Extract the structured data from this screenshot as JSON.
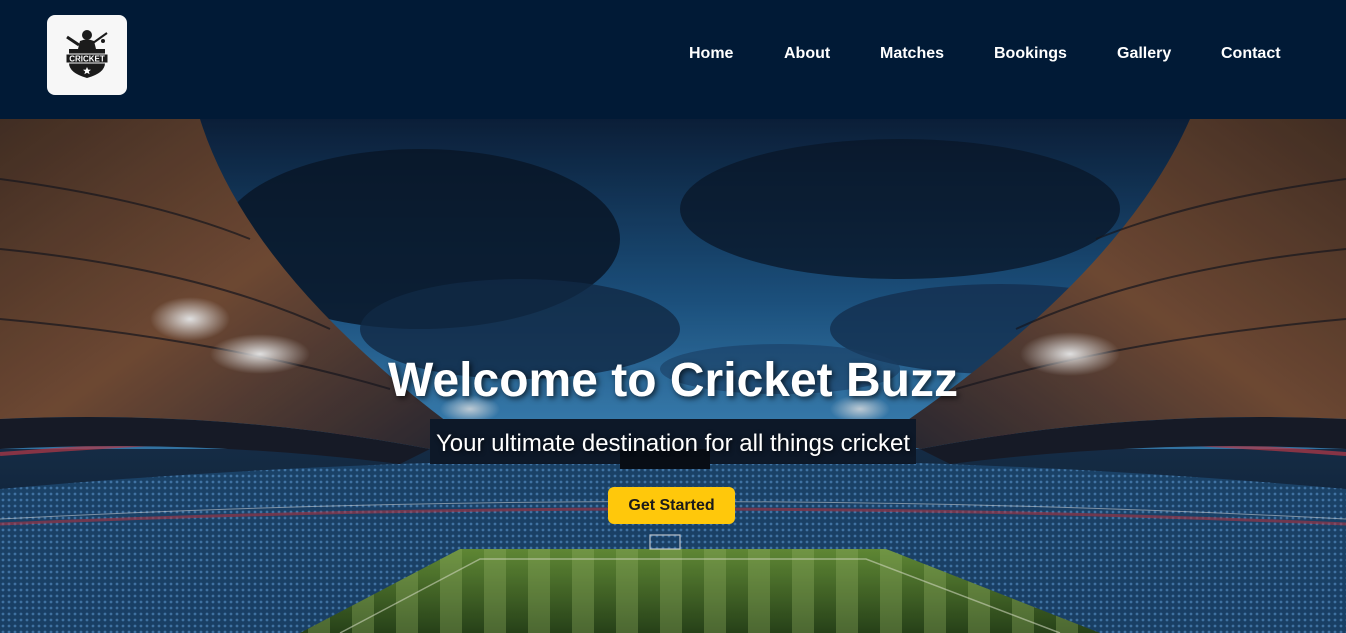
{
  "brand": {
    "logo_text": "CRICKET"
  },
  "nav": {
    "items": [
      {
        "label": "Home"
      },
      {
        "label": "About"
      },
      {
        "label": "Matches"
      },
      {
        "label": "Bookings"
      },
      {
        "label": "Gallery"
      },
      {
        "label": "Contact"
      }
    ]
  },
  "hero": {
    "title": "Welcome to Cricket Buzz",
    "subtitle": "Your ultimate destination for all things cricket",
    "cta_label": "Get Started"
  },
  "colors": {
    "nav_background": "#011a36",
    "cta_background": "#ffc80b",
    "text": "#ffffff"
  },
  "icons": {
    "logo": "cricket-player-shield-icon"
  }
}
